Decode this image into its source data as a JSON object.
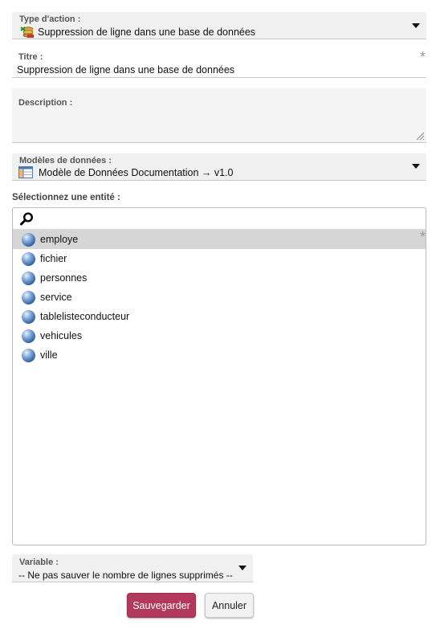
{
  "action_type": {
    "label": "Type d'action :",
    "value": "Suppression de ligne dans une base de données",
    "icon": "database-delete-icon"
  },
  "title_field": {
    "label": "Titre :",
    "value": "Suppression de ligne dans une base de données",
    "required_mark": "*"
  },
  "description_field": {
    "label": "Description :",
    "value": ""
  },
  "data_model": {
    "label": "Modèles de données :",
    "value": "Modèle de Données Documentation → v1.0",
    "icon": "data-model-icon"
  },
  "entity_select": {
    "label": "Sélectionnez une entité :",
    "search_placeholder": "",
    "required_mark": "*",
    "selected": "employe",
    "items": [
      {
        "name": "employe"
      },
      {
        "name": "fichier"
      },
      {
        "name": "personnes"
      },
      {
        "name": "service"
      },
      {
        "name": "tablelisteconducteur"
      },
      {
        "name": "vehicules"
      },
      {
        "name": "ville"
      }
    ]
  },
  "variable": {
    "label": "Variable :",
    "value": "-- Ne pas sauver le nombre de lignes supprimés --"
  },
  "buttons": {
    "save": "Sauvegarder",
    "cancel": "Annuler"
  },
  "colors": {
    "save_button": "#b3395c",
    "selected_row": "#d6d6d6",
    "field_background": "#f0f0f0"
  }
}
